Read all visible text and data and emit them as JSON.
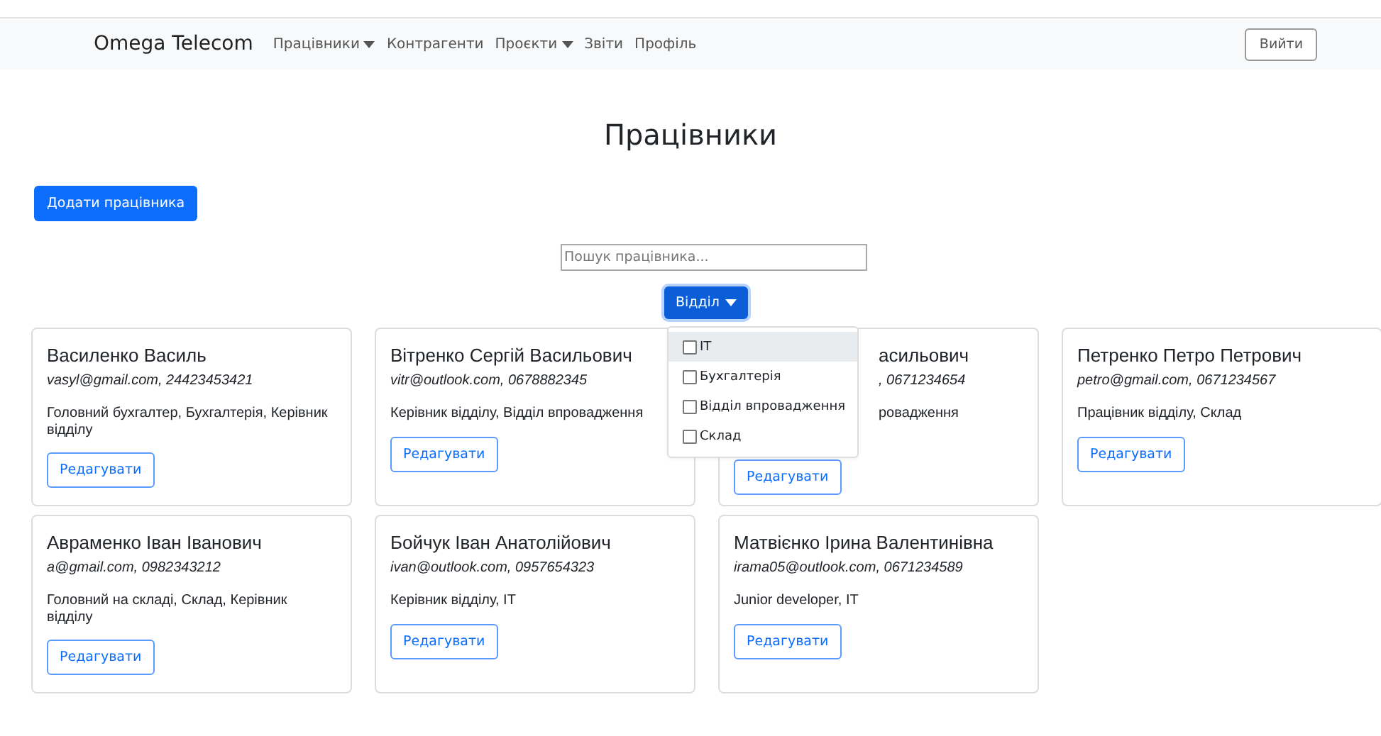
{
  "navbar": {
    "brand": "Omega Telecom",
    "links": [
      {
        "label": "Працівники",
        "caret": true
      },
      {
        "label": "Контрагенти",
        "caret": false
      },
      {
        "label": "Проєкти",
        "caret": true
      },
      {
        "label": "Звіти",
        "caret": false
      },
      {
        "label": "Профіль",
        "caret": false
      }
    ],
    "logout": "Вийти"
  },
  "page_title": "Працівники",
  "add_button": "Додати працівника",
  "search": {
    "placeholder": "Пошук працівника..."
  },
  "filter": {
    "label": "Відділ",
    "expanded": true,
    "options": [
      {
        "label": "IT",
        "checked": false,
        "highlighted": true
      },
      {
        "label": "Бухгалтерія",
        "checked": false,
        "highlighted": false
      },
      {
        "label": "Відділ впровадження",
        "checked": false,
        "highlighted": false
      },
      {
        "label": "Склад",
        "checked": false,
        "highlighted": false
      }
    ]
  },
  "employees": [
    {
      "name": "Василенко Василь",
      "contact": "vasyl@gmail.com, 24423453421",
      "roles": "Головний бухгалтер, Бухгалтерія, Керівник відділу",
      "button": "Редагувати",
      "covered": false
    },
    {
      "name": "Вітренко Сергій Васильович",
      "contact": "vitr@outlook.com, 0678882345",
      "roles": "Керівник відділу, Відділ впровадження",
      "button": "Редагувати",
      "covered": false
    },
    {
      "name": "асильович",
      "contact": ", 0671234654",
      "roles": "ровадження",
      "button": "Редагувати",
      "covered": true
    },
    {
      "name": "Петренко Петро Петрович",
      "contact": "petro@gmail.com, 0671234567",
      "roles": "Працівник відділу, Склад",
      "button": "Редагувати",
      "covered": false
    },
    {
      "name": "Авраменко Іван Іванович",
      "contact": "a@gmail.com, 0982343212",
      "roles": "Головний на складі, Склад, Керівник відділу",
      "button": "Редагувати",
      "covered": false
    },
    {
      "name": "Бойчук Іван Анатолійович",
      "contact": "ivan@outlook.com, 0957654323",
      "roles": "Керівник відділу, IT",
      "button": "Редагувати",
      "covered": false
    },
    {
      "name": "Матвієнко Ірина Валентинівна",
      "contact": "irama05@outlook.com, 0671234589",
      "roles": "Junior developer, IT",
      "button": "Редагувати",
      "covered": false
    }
  ]
}
